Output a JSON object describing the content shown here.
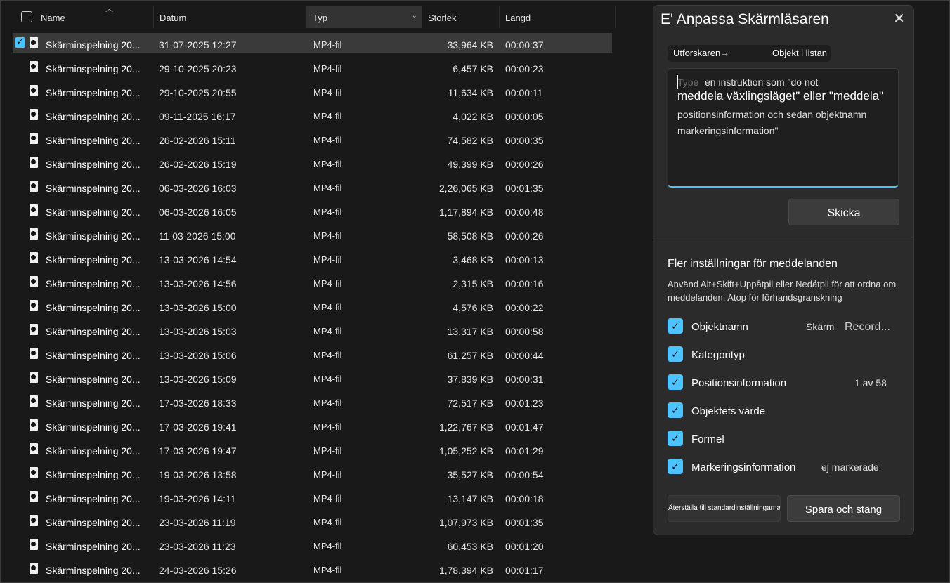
{
  "columns": {
    "name": "Name",
    "date": "Datum",
    "type": "Typ",
    "size": "Storlek",
    "length": "Längd"
  },
  "files": [
    {
      "name": "Skärminspelning 20...",
      "date": "31-07-2025 12:27",
      "type": "MP4-fil",
      "size": "33,964 KB",
      "length": "00:00:37",
      "selected": true
    },
    {
      "name": "Skärminspelning 20...",
      "date": "29-10-2025 20:23",
      "type": "MP4-fil",
      "size": "6,457 KB",
      "length": "00:00:23"
    },
    {
      "name": "Skärminspelning 20...",
      "date": "29-10-2025 20:55",
      "type": "MP4-fil",
      "size": "11,634 KB",
      "length": "00:00:11"
    },
    {
      "name": "Skärminspelning 20...",
      "date": "09-11-2025 16:17",
      "type": "MP4-fil",
      "size": "4,022 KB",
      "length": "00:00:05"
    },
    {
      "name": "Skärminspelning 20...",
      "date": "26-02-2026 15:11",
      "type": "MP4-fil",
      "size": "74,582 KB",
      "length": "00:00:35"
    },
    {
      "name": "Skärminspelning 20...",
      "date": "26-02-2026 15:19",
      "type": "MP4-fil",
      "size": "49,399 KB",
      "length": "00:00:26"
    },
    {
      "name": "Skärminspelning 20...",
      "date": "06-03-2026 16:03",
      "type": "MP4-fil",
      "size": "2,26,065 KB",
      "length": "00:01:35"
    },
    {
      "name": "Skärminspelning 20...",
      "date": "06-03-2026 16:05",
      "type": "MP4-fil",
      "size": "1,17,894 KB",
      "length": "00:00:48"
    },
    {
      "name": "Skärminspelning 20...",
      "date": "11-03-2026 15:00",
      "type": "MP4-fil",
      "size": "58,508 KB",
      "length": "00:00:26"
    },
    {
      "name": "Skärminspelning 20...",
      "date": "13-03-2026 14:54",
      "type": "MP4-fil",
      "size": "3,468 KB",
      "length": "00:00:13"
    },
    {
      "name": "Skärminspelning 20...",
      "date": "13-03-2026 14:56",
      "type": "MP4-fil",
      "size": "2,315 KB",
      "length": "00:00:16"
    },
    {
      "name": "Skärminspelning 20...",
      "date": "13-03-2026 15:00",
      "type": "MP4-fil",
      "size": "4,576 KB",
      "length": "00:00:22"
    },
    {
      "name": "Skärminspelning 20...",
      "date": "13-03-2026 15:03",
      "type": "MP4-fil",
      "size": "13,317 KB",
      "length": "00:00:58"
    },
    {
      "name": "Skärminspelning 20...",
      "date": "13-03-2026 15:06",
      "type": "MP4-fil",
      "size": "61,257 KB",
      "length": "00:00:44"
    },
    {
      "name": "Skärminspelning 20...",
      "date": "13-03-2026 15:09",
      "type": "MP4-fil",
      "size": "37,839 KB",
      "length": "00:00:31"
    },
    {
      "name": "Skärminspelning 20...",
      "date": "17-03-2026 18:33",
      "type": "MP4-fil",
      "size": "72,517 KB",
      "length": "00:01:23"
    },
    {
      "name": "Skärminspelning 20...",
      "date": "17-03-2026 19:41",
      "type": "MP4-fil",
      "size": "1,22,767 KB",
      "length": "00:01:47"
    },
    {
      "name": "Skärminspelning 20...",
      "date": "17-03-2026 19:47",
      "type": "MP4-fil",
      "size": "1,05,252 KB",
      "length": "00:01:29"
    },
    {
      "name": "Skärminspelning 20...",
      "date": "19-03-2026 13:58",
      "type": "MP4-fil",
      "size": "35,527 KB",
      "length": "00:00:54"
    },
    {
      "name": "Skärminspelning 20...",
      "date": "19-03-2026 14:11",
      "type": "MP4-fil",
      "size": "13,147 KB",
      "length": "00:00:18"
    },
    {
      "name": "Skärminspelning 20...",
      "date": "23-03-2026 11:19",
      "type": "MP4-fil",
      "size": "1,07,973 KB",
      "length": "00:01:35"
    },
    {
      "name": "Skärminspelning 20...",
      "date": "23-03-2026 11:23",
      "type": "MP4-fil",
      "size": "60,453 KB",
      "length": "00:01:20"
    },
    {
      "name": "Skärminspelning 20...",
      "date": "24-03-2026 15:26",
      "type": "MP4-fil",
      "size": "1,78,394 KB",
      "length": "00:01:17"
    }
  ],
  "dialog": {
    "title": "E' Anpassa Skärmläsaren",
    "close_glyph": "✕",
    "segment_left": "Utforskaren→",
    "segment_right": "Objekt i listan",
    "placeholder": "Type",
    "instruction_1": "en instruktion som \"do not",
    "instruction_2": "meddela växlingsläget\" eller \"meddela\"",
    "instruction_3": "positionsinformation och sedan objektnamn",
    "instruction_4": "markeringsinformation\"",
    "send_label": "Skicka",
    "section_title": "Fler inställningar för meddelanden",
    "section_desc": "Använd Alt+Skift+Uppåtpil eller Nedåtpil för att ordna om meddelanden, Atop för förhandsgranskning",
    "options": [
      {
        "label": "Objektnamn",
        "value": "Skärm",
        "value2": "Record...",
        "checked": true
      },
      {
        "label": "Kategorityp",
        "value": "",
        "checked": true
      },
      {
        "label": "Positionsinformation",
        "value": "1 av 58",
        "checked": true
      },
      {
        "label": "Objektets värde",
        "value": "",
        "checked": true
      },
      {
        "label": "Formel",
        "value": "",
        "checked": true
      },
      {
        "label": "Markeringsinformation",
        "value": "ej markerade",
        "checked": true
      }
    ],
    "reset_label": "Återställa till standardinställningarna",
    "save_label": "Spara och stäng"
  },
  "colors": {
    "accent": "#4cc2ff",
    "background": "#191919",
    "dialog": "#2b2b2b"
  }
}
